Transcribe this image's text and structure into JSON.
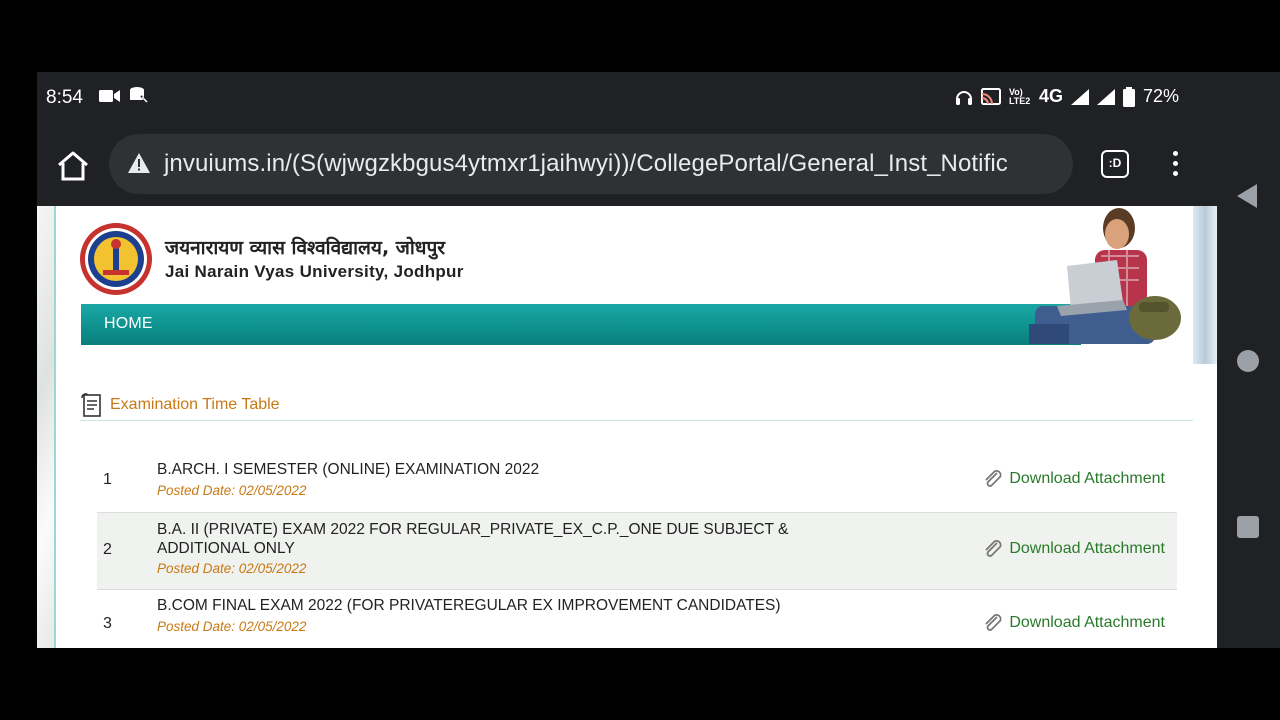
{
  "statusbar": {
    "time": "8:54",
    "network": "4G",
    "volte": "Vo) LTE2",
    "battery": "72%"
  },
  "browser": {
    "url": "jnvuiums.in/(S(wjwgzkbgus4ytmxr1jaihwyi))/CollegePortal/General_Inst_Notific",
    "tab_label": ":D"
  },
  "site": {
    "name_hindi": "जयनारायण व्यास विश्वविद्यालय, जोधपुर",
    "name_english": "Jai Narain Vyas University, Jodhpur",
    "nav_home": "HOME"
  },
  "section": {
    "title": "Examination Time Table"
  },
  "notices": [
    {
      "num": "1",
      "title": "B.ARCH. I SEMESTER (ONLINE) EXAMINATION 2022",
      "date": "Posted Date: 02/05/2022",
      "download": "Download Attachment"
    },
    {
      "num": "2",
      "title": "B.A. II (PRIVATE) EXAM 2022 FOR REGULAR_PRIVATE_EX_C.P._ONE DUE SUBJECT & ADDITIONAL ONLY",
      "date": "Posted Date: 02/05/2022",
      "download": "Download Attachment"
    },
    {
      "num": "3",
      "title": "B.COM FINAL EXAM 2022 (FOR PRIVATEREGULAR EX IMPROVEMENT CANDIDATES)",
      "date": "Posted Date: 02/05/2022",
      "download": "Download Attachment"
    }
  ]
}
